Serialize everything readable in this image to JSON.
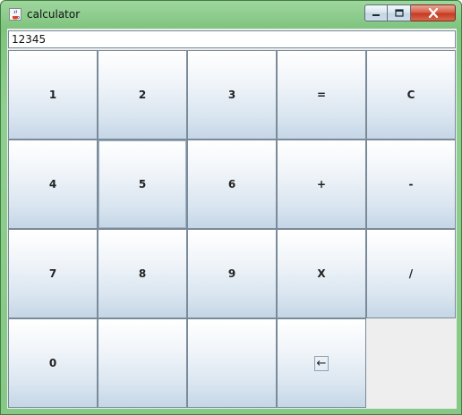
{
  "window": {
    "title": "calculator",
    "icon": "java-cup-icon",
    "controls": [
      "minimize-icon",
      "maximize-icon",
      "close-icon"
    ]
  },
  "display": {
    "value": "12345"
  },
  "keypad": {
    "rows": [
      [
        "1",
        "2",
        "3",
        "=",
        "C"
      ],
      [
        "4",
        "5",
        "6",
        "+",
        "-"
      ],
      [
        "7",
        "8",
        "9",
        "X",
        "/"
      ],
      [
        "0",
        "",
        "",
        "←"
      ]
    ]
  },
  "colors": {
    "titlebar": "#8fcf8f",
    "key_top": "#ffffff",
    "key_bottom": "#c5d6e6",
    "key_border": "#7a8a99",
    "close_button": "#c53a22"
  }
}
